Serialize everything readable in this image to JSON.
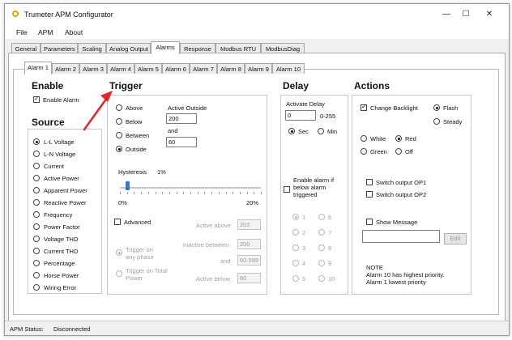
{
  "window": {
    "title": "Trumeter APM Configurator",
    "minimize": "—",
    "maximize": "☐",
    "close": "✕"
  },
  "menu": [
    "File",
    "APM",
    "About"
  ],
  "main_tabs": [
    "General",
    "Parameters",
    "Scaling",
    "Analog Output",
    "Alarms",
    "Response",
    "Modbus RTU",
    "ModbusDiag"
  ],
  "alarm_tabs": [
    "Alarm 1",
    "Alarm 2",
    "Alarm 3",
    "Alarm 4",
    "Alarm 5",
    "Alarm 6",
    "Alarm 7",
    "Alarm 8",
    "Alarm 9",
    "Alarm 10"
  ],
  "enable": {
    "heading": "Enable",
    "checkbox_label": "Enable Alarm",
    "checked": true
  },
  "source": {
    "heading": "Source",
    "options": [
      "L-L Voltage",
      "L-N Voltage",
      "Current",
      "Active Power",
      "Apparent Power",
      "Reactive Power",
      "Frequency",
      "Power Factor",
      "Voltage THD",
      "Current THD",
      "Percentage",
      "Horse Power",
      "Wiring Error"
    ],
    "selected": "L-L Voltage"
  },
  "trigger": {
    "heading": "Trigger",
    "modes": [
      "Above",
      "Below",
      "Between",
      "Outside"
    ],
    "selected_mode": "Outside",
    "active_outside_label": "Active Outside",
    "value_1": "200",
    "and_label": "and",
    "value_2": "60",
    "hysteresis_label": "Hysteresis",
    "hysteresis_value": "1%",
    "hysteresis_fraction": 0.05,
    "slider_min": "0%",
    "slider_max": "20%",
    "advanced_label": "Advanced",
    "advanced_checked": false,
    "phase_options": [
      "Trigger on any phase",
      "Trigger on Total Power"
    ],
    "active_above_label": "Active above",
    "active_above_value": "202",
    "inactive_between_label": "Inactive between",
    "inactive_between_value": "200",
    "and_label_2": "and",
    "and_value_2": "60.599",
    "active_below_label": "Active below",
    "active_below_value": "60"
  },
  "delay": {
    "heading": "Delay",
    "activate_delay_label": "Activate Delay",
    "value": "0",
    "range": "0-255",
    "unit_options": [
      "Sec",
      "Min"
    ],
    "selected_unit": "Sec",
    "enable_below_label": "Enable alarm if below alarm triggered",
    "enable_below_checked": false,
    "alarm_numbers": [
      "1",
      "2",
      "3",
      "4",
      "5",
      "6",
      "7",
      "8",
      "9",
      "10"
    ],
    "selected_alarm": "1"
  },
  "actions": {
    "heading": "Actions",
    "change_backlight_label": "Change Backlight",
    "change_backlight_checked": true,
    "flash_label": "Flash",
    "steady_label": "Steady",
    "flash_selected": true,
    "colors": [
      "White",
      "Red",
      "Green",
      "Off"
    ],
    "selected_color": "Red",
    "switch_op1_label": "Switch output OP1",
    "switch_op2_label": "Switch output OP2",
    "show_message_label": "Show Message",
    "message_value": "",
    "edit_label": "Edit",
    "note_title": "NOTE",
    "note_line1": "Alarm 10 has highest priority.",
    "note_line2": "Alarm 1 lowest priority"
  },
  "status": {
    "label": "APM Status:",
    "value": "Disconnected"
  },
  "colors": {
    "annotation_arrow": "#e8202a",
    "slider_thumb": "#2a7ad6"
  }
}
